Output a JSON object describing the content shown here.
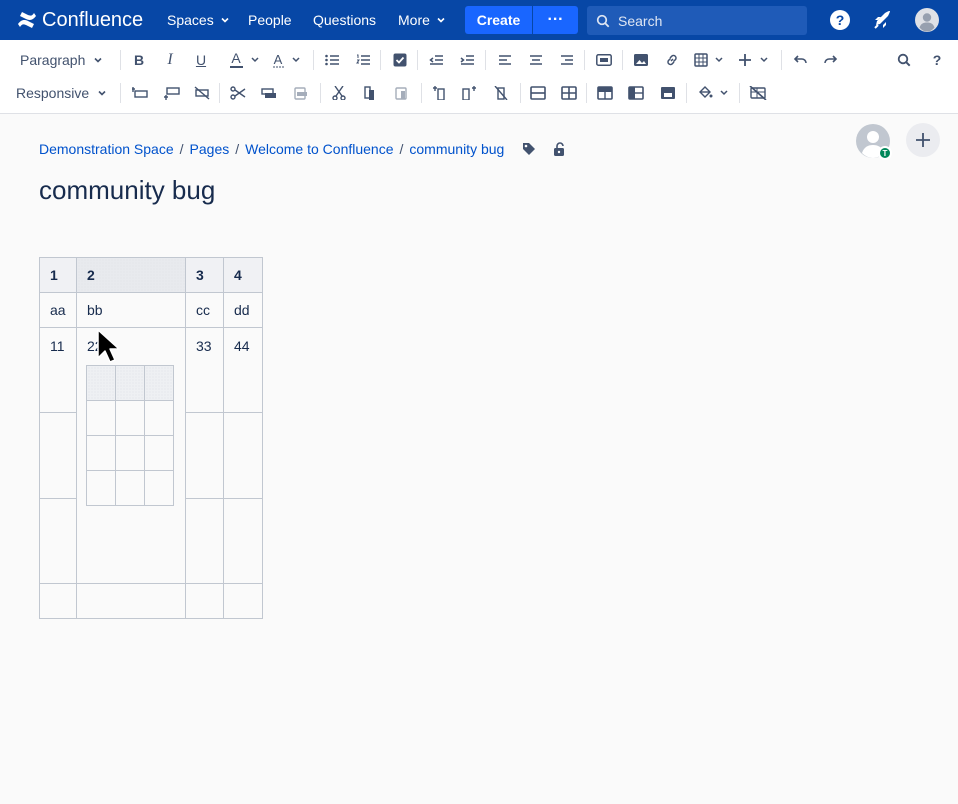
{
  "topnav": {
    "logo_text": "Confluence",
    "spaces": "Spaces",
    "people": "People",
    "questions": "Questions",
    "more": "More",
    "create": "Create",
    "more_actions": "···",
    "search_placeholder": "Search",
    "icons": [
      "help-icon",
      "notifications-icon",
      "profile-avatar"
    ],
    "brand_color": "#0747a6",
    "create_color": "#1966ff"
  },
  "toolbar": {
    "paragraph": "Paragraph",
    "responsive": "Responsive",
    "row1_icons": [
      "bold",
      "italic",
      "underline",
      "text-color",
      "text-effects",
      "bullet-list",
      "numbered-list",
      "task",
      "outdent",
      "indent",
      "align-left",
      "align-center",
      "align-right",
      "page-layout",
      "image",
      "link",
      "table",
      "insert-more",
      "undo",
      "redo",
      "find",
      "help"
    ],
    "row2_icons": [
      "insert-row-before",
      "insert-row-after",
      "delete-row",
      "cut-row",
      "copy-row",
      "paste-row",
      "cut-column",
      "copy-column",
      "paste-column",
      "insert-column-before",
      "insert-column-after",
      "delete-column",
      "merge-cells",
      "split-cell",
      "heading-row",
      "heading-column",
      "numbered-column",
      "cell-color",
      "delete-table"
    ]
  },
  "breadcrumb": [
    "Demonstration Space",
    "Pages",
    "Welcome to Confluence",
    "community bug"
  ],
  "breadcrumb_sep": "/",
  "page": {
    "title": "community bug",
    "avatar_badge": "T"
  },
  "table": {
    "headers": [
      "1",
      "2",
      "3",
      "4"
    ],
    "row2": [
      "aa",
      "bb",
      "cc",
      "dd"
    ],
    "row3": [
      "11",
      "22",
      "33",
      "44"
    ]
  }
}
